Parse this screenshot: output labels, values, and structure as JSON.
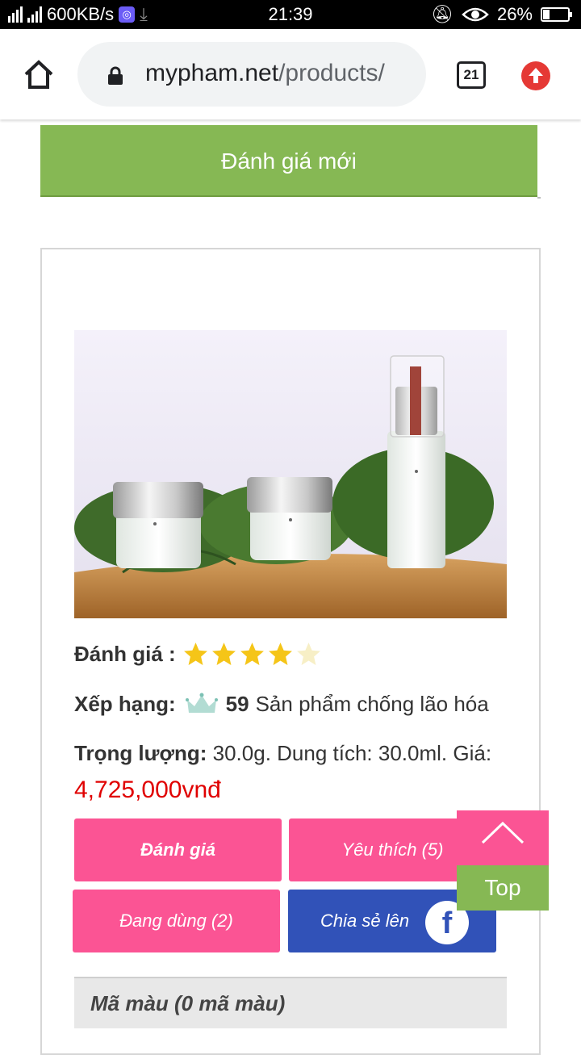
{
  "status_bar": {
    "speed": "600KB/s",
    "time": "21:39",
    "battery": "26%",
    "battery_level": 0.26,
    "icons": [
      "signal-icon",
      "vpn-icon",
      "download-icon",
      "mute-icon",
      "eye-icon",
      "battery-icon"
    ]
  },
  "browser": {
    "url_domain": "mypham.net",
    "url_path": "/products/",
    "tab_count": "21",
    "icons": [
      "home-icon",
      "lock-icon",
      "tabs-icon",
      "update-icon"
    ]
  },
  "page": {
    "new_review_label": "Đánh giá mới",
    "rating_label": "Đánh giá :",
    "rating_value": 4,
    "rating_max": 5,
    "rank_label": "Xếp hạng:",
    "rank_number": "59",
    "rank_category": "Sản phẩm chống lão hóa",
    "weight_label": "Trọng lượng:",
    "weight_text": " 30.0g. Dung tích: 30.0ml. Giá:",
    "price": "4,725,000vnđ",
    "buttons": {
      "review": "Đánh giá",
      "favorite": "Yêu thích (5)",
      "using": "Đang dùng (2)",
      "share": "Chia sẻ lên"
    },
    "top_label": "Top",
    "colors_label": "Mã màu (0 mã màu)"
  },
  "colors": {
    "green": "#86b854",
    "pink": "#fb5494",
    "blue": "#3152b8",
    "price_red": "#e00000",
    "star_gold": "#f5c518"
  }
}
